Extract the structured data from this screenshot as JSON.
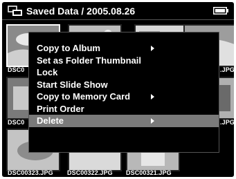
{
  "title": "Saved Data / 2005.08.26",
  "icons": {
    "folder": "folder-icon",
    "battery": "battery-icon",
    "submenu": "chevron-right-icon"
  },
  "thumbnails": {
    "row1_left": "DSC0",
    "row1_right": ".JPG",
    "row2_left": "DSC0",
    "row2_right": ".JPG",
    "bottom": [
      "DSC00323.JPG",
      "DSC00322.JPG",
      "DSC00321.JPG"
    ]
  },
  "menu": {
    "items": [
      {
        "label": "Copy to Album",
        "submenu": true
      },
      {
        "label": "Set as Folder Thumbnail",
        "submenu": false
      },
      {
        "label": "Lock",
        "submenu": false
      },
      {
        "label": "Start Slide Show",
        "submenu": false
      },
      {
        "label": "Copy to Memory Card",
        "submenu": true
      },
      {
        "label": "Print Order",
        "submenu": false
      },
      {
        "label": "Delete",
        "submenu": true
      }
    ],
    "selected_index": 6
  },
  "colors": {
    "screen_bg": "#000000",
    "text": "#ffffff",
    "highlight": "#7a7a7a",
    "selected_border": "#ffffff"
  }
}
